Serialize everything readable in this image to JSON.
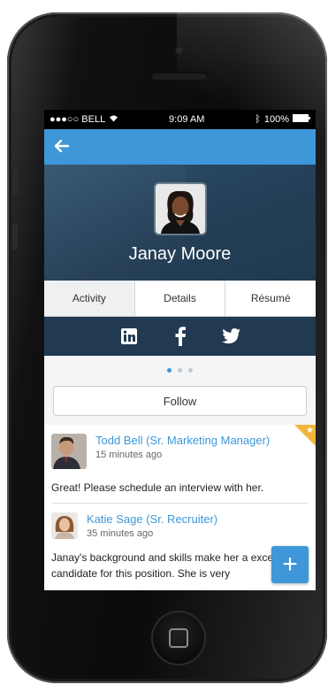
{
  "status_bar": {
    "carrier": "●●●○○ BELL",
    "time": "9:09 AM",
    "battery": "100%"
  },
  "nav": {
    "back_icon": "arrow-left-icon"
  },
  "profile": {
    "name": "Janay Moore"
  },
  "tabs": [
    {
      "label": "Activity",
      "active": true
    },
    {
      "label": "Details",
      "active": false
    },
    {
      "label": "Résumé",
      "active": false
    }
  ],
  "social": [
    "linkedin-icon",
    "facebook-icon",
    "twitter-icon"
  ],
  "pager": {
    "pages": 3,
    "current": 1
  },
  "follow_label": "Follow",
  "feed": [
    {
      "name": "Todd Bell (Sr. Marketing Manager)",
      "time": "15 minutes ago",
      "message": "Great! Please schedule an interview with her.",
      "starred": true
    },
    {
      "name": "Katie Sage (Sr. Recruiter)",
      "time": "35 minutes ago",
      "message": "Janay's background and skills make her a excellent candidate for this position. She is very",
      "starred": false
    }
  ],
  "fab_label": "+",
  "colors": {
    "accent": "#3d97d8",
    "header_bg": "#233d55",
    "social_bg": "#213a52",
    "star": "#f1b43c"
  }
}
